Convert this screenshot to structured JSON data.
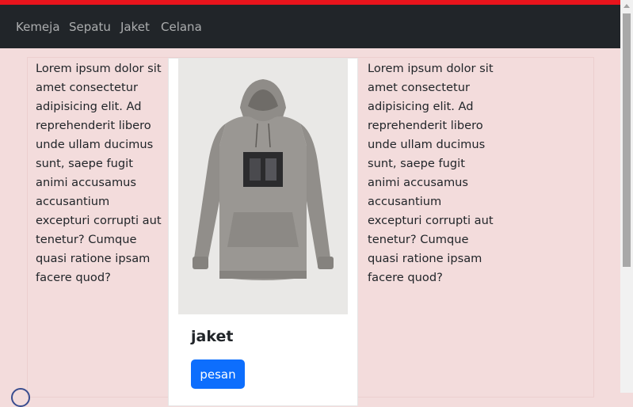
{
  "nav": {
    "items": [
      "Kemeja",
      "Sepatu",
      "Jaket",
      "Celana"
    ]
  },
  "left_column": {
    "text_lines": [
      "Lorem ipsum dolor sit",
      "amet consectetur",
      "adipisicing elit. Ad",
      "reprehenderit libero",
      "unde ullam ducimus",
      "sunt, saepe fugit",
      "animi accusamus",
      "accusantium",
      "excepturi corrupti aut",
      "tenetur? Cumque",
      "quasi ratione ipsam",
      "facere quod?"
    ]
  },
  "card": {
    "image_icon": "hoodie-image",
    "title": "jaket",
    "button_label": "pesan"
  },
  "right_column": {
    "text_lines": [
      "Lorem ipsum dolor sit",
      "amet consectetur",
      "adipisicing elit. Ad",
      "reprehenderit libero",
      "unde ullam ducimus",
      "sunt, saepe fugit",
      "animi accusamus",
      "accusantium",
      "excepturi corrupti aut",
      "tenetur? Cumque",
      "quasi ratione ipsam",
      "facere quod?"
    ]
  },
  "colors": {
    "top_accent": "#e8141c",
    "navbar_bg": "#212529",
    "page_bg": "#f3dcdc",
    "button_bg": "#0d6efd"
  }
}
